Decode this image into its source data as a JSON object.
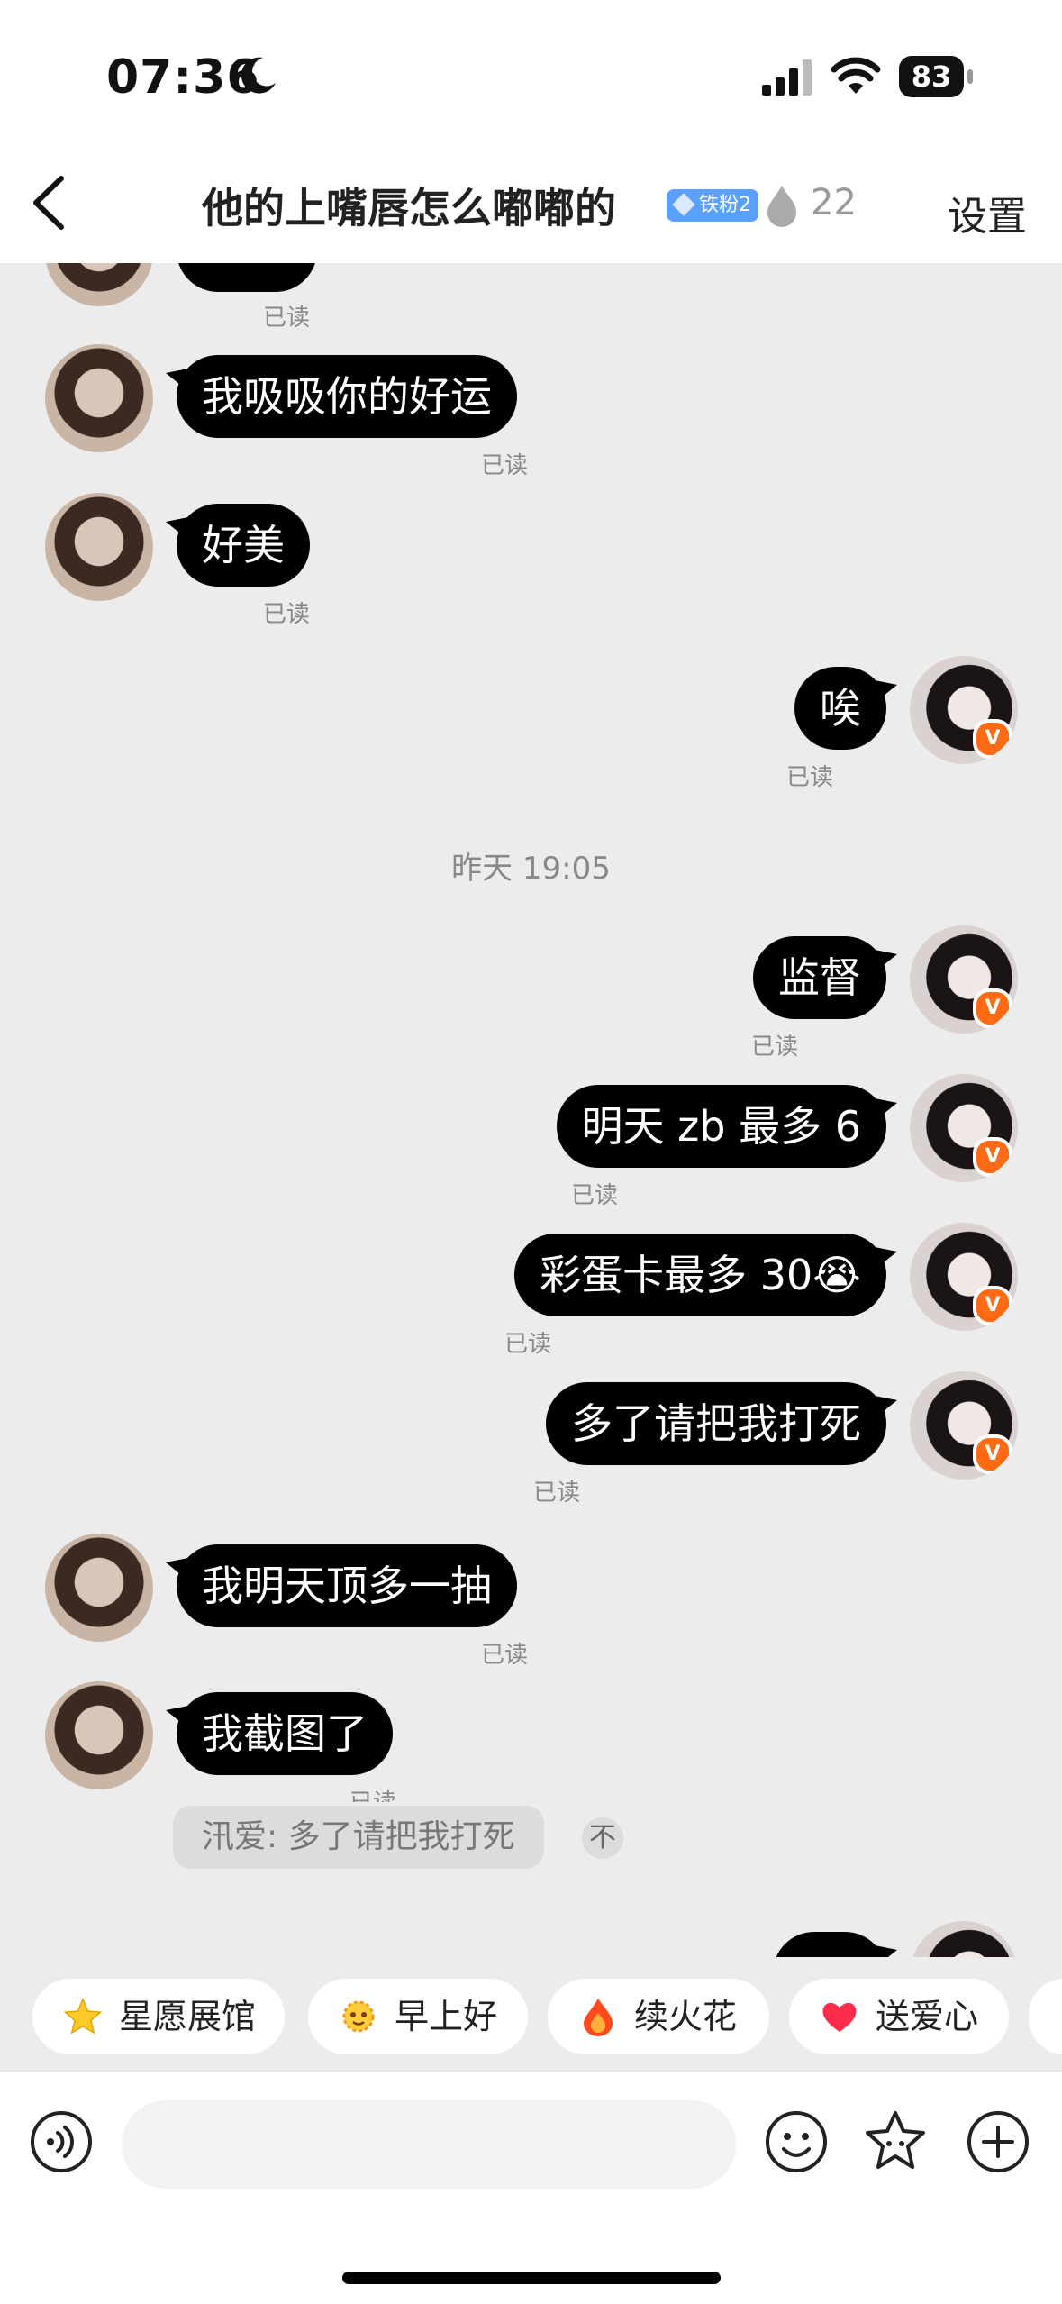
{
  "status_bar": {
    "time": "07:36",
    "battery": "83"
  },
  "header": {
    "title": "他的上嘴唇怎么嘟嘟的",
    "badge": "铁粉2",
    "flame_count": "22",
    "settings": "设置"
  },
  "messages": [
    {
      "side": "left",
      "text": "我吸吸你的好运",
      "read": "已读"
    },
    {
      "side": "left",
      "text": "好美",
      "read": "已读"
    },
    {
      "side": "right",
      "text": "唉",
      "read": "已读"
    },
    {
      "side": "right",
      "text": "监督",
      "read": "已读"
    },
    {
      "side": "right",
      "text": "明天 zb 最多 6",
      "read": "已读"
    },
    {
      "side": "right",
      "text": "彩蛋卡最多 30😭",
      "read": "已读"
    },
    {
      "side": "right",
      "text": "多了请把我打死",
      "read": "已读"
    },
    {
      "side": "left",
      "text": "我明天顶多一抽",
      "read": "已读"
    },
    {
      "side": "left",
      "text": "我截图了",
      "read": "已读"
    }
  ],
  "partial_top": {
    "read": "已读"
  },
  "timestamp": "昨天 19:05",
  "quote": {
    "text": "汛爱: 多了请把我打死",
    "top_glyph": "不"
  },
  "chips": [
    {
      "icon": "star-emoji-icon",
      "label": "星愿展馆"
    },
    {
      "icon": "sun-emoji-icon",
      "label": "早上好"
    },
    {
      "icon": "fire-emoji-icon",
      "label": "续火花"
    },
    {
      "icon": "heart-emoji-icon",
      "label": "送爱心"
    }
  ],
  "input": {
    "placeholder": ""
  },
  "colors": {
    "accent": "#ff6a13",
    "bubble": "#000000",
    "badge": "#5aa0ff"
  }
}
